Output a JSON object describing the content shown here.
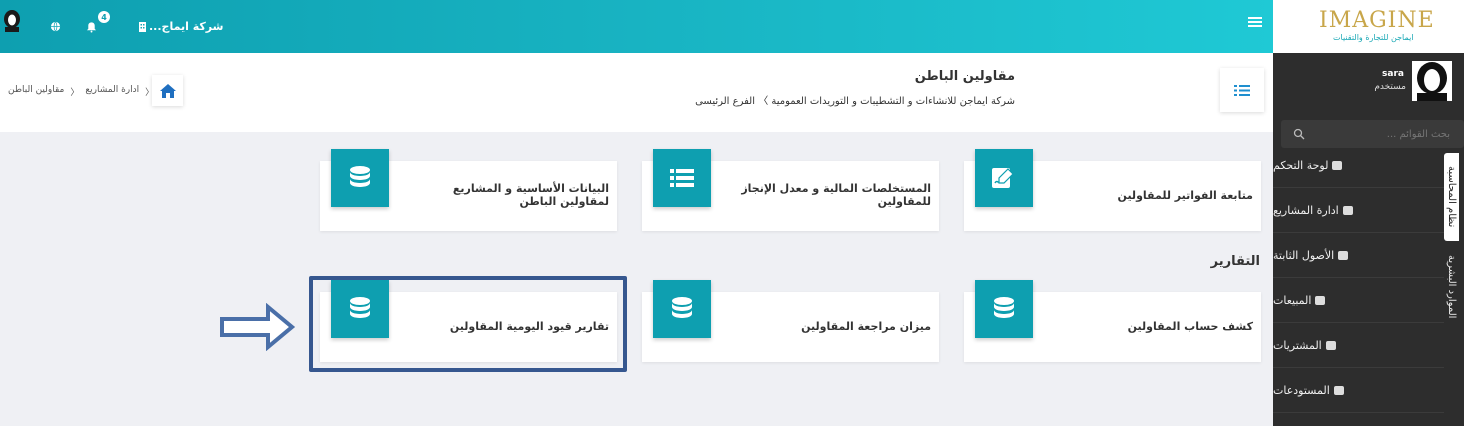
{
  "topbar": {
    "company": "شركة ايماج...",
    "notifications_count": "4"
  },
  "logo": {
    "main": "IMAGINE",
    "sub": "ايماجن للتجارة والتقنيات"
  },
  "sidebar": {
    "user_name": "sara",
    "user_role": "مستخدم",
    "search_placeholder": "بحث القوائم ...",
    "items": [
      {
        "label": "لوحة التحكم"
      },
      {
        "label": "ادارة المشاريع"
      },
      {
        "label": "الأصول الثابتة"
      },
      {
        "label": "المبيعات"
      },
      {
        "label": "المشتريات"
      },
      {
        "label": "المستودعات"
      }
    ],
    "tabs": [
      {
        "label": "نظام المحاسبة"
      },
      {
        "label": "الموارد البشرية"
      }
    ]
  },
  "header": {
    "title": "مقاولين الباطن",
    "subtitle": "شركة ايماجن للانشاءات و التشطيبات و التوريدات العمومية  〉 الفرع الرئيسى",
    "breadcrumb": [
      "ادارة المشاريع",
      "مقاولين الباطن"
    ]
  },
  "cards": [
    {
      "label": "متابعة الفواتير للمقاولين",
      "icon": "invoice-edit-icon"
    },
    {
      "label": "المستخلصات المالية و معدل الإنجاز للمقاولين",
      "icon": "list-icon"
    },
    {
      "label": "البيانات الأساسية و المشاريع لمقاولين الباطن",
      "icon": "database-icon"
    }
  ],
  "reports": {
    "title": "التقارير",
    "cards": [
      {
        "label": "كشف حساب المقاولين",
        "icon": "database-icon"
      },
      {
        "label": "ميزان مراجعة المقاولين",
        "icon": "database-icon"
      },
      {
        "label": "تقارير قيود اليومية المقاولين",
        "icon": "database-icon"
      }
    ]
  },
  "colors": {
    "accent": "#0e9fb0",
    "highlight": "#36578f",
    "sidebar": "#2d2d2d"
  }
}
